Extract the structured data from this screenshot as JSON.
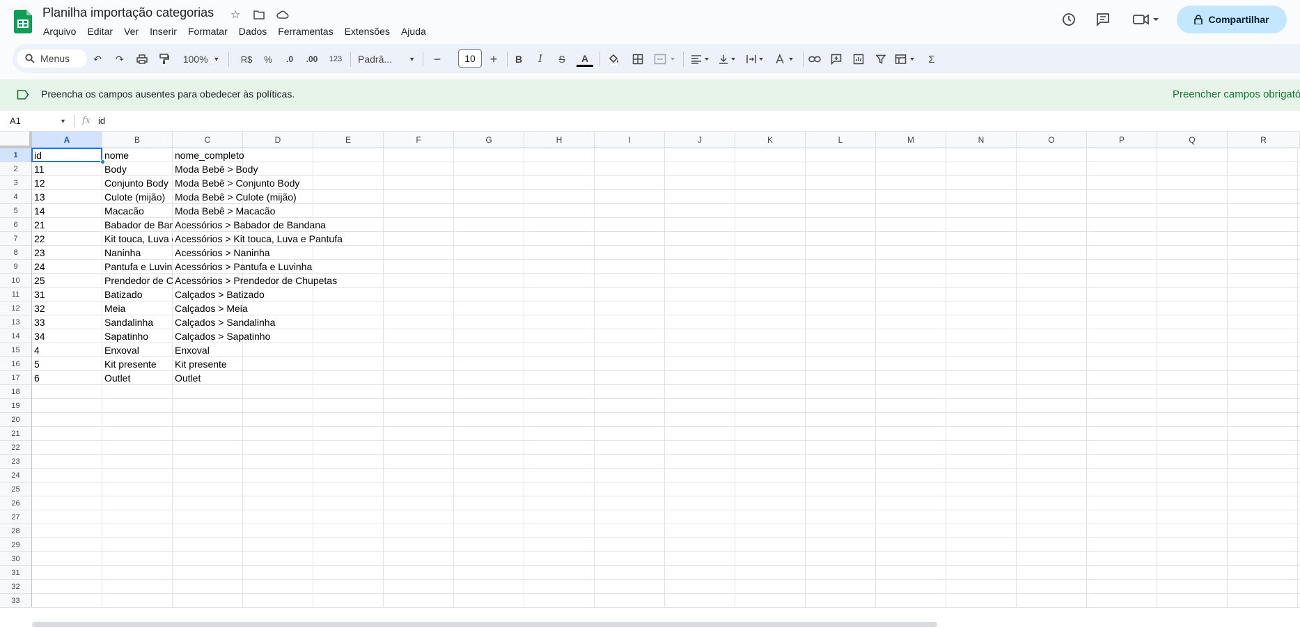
{
  "app": {
    "title": "Planilha importação categorias",
    "menu": [
      "Arquivo",
      "Editar",
      "Ver",
      "Inserir",
      "Formatar",
      "Dados",
      "Ferramentas",
      "Extensões",
      "Ajuda"
    ],
    "share_label": "Compartilhar"
  },
  "toolbar": {
    "search_label": "Menus",
    "zoom": "100%",
    "currency": "R$",
    "percent": "%",
    "dec_less": ".0",
    "dec_more": ".00",
    "number_format": "123",
    "font_name": "Padrã...",
    "font_size": "10",
    "minus": "−",
    "plus": "+",
    "bold": "B",
    "italic": "I",
    "strike": "S",
    "text_color": "A",
    "sum": "Σ"
  },
  "banner": {
    "text": "Preencha os campos ausentes para obedecer às políticas.",
    "action": "Preencher campos obrigatórios"
  },
  "formula_bar": {
    "cell_ref": "A1",
    "fx": "fx",
    "value": "id"
  },
  "sheet": {
    "columns": [
      "A",
      "B",
      "C",
      "D",
      "E",
      "F",
      "G",
      "H",
      "I",
      "J",
      "K",
      "L",
      "M",
      "N",
      "O",
      "P",
      "Q",
      "R"
    ],
    "rows_count": 33,
    "data": [
      [
        "id",
        "nome",
        "nome_completo"
      ],
      [
        "11",
        "Body",
        "Moda Bebê  > Body"
      ],
      [
        "12",
        "Conjunto Body",
        "Moda Bebê  > Conjunto Body"
      ],
      [
        "13",
        "Culote (mijão)",
        "Moda Bebê  > Culote (mijão)"
      ],
      [
        "14",
        "Macacão",
        "Moda Bebê  > Macacão"
      ],
      [
        "21",
        "Babador de Bandana",
        "Acessórios > Babador de Bandana"
      ],
      [
        "22",
        "Kit touca, Luva e Pantufa",
        "Acessórios > Kit touca, Luva e Pantufa"
      ],
      [
        "23",
        "Naninha",
        "Acessórios > Naninha"
      ],
      [
        "24",
        "Pantufa e Luvinha",
        "Acessórios > Pantufa e Luvinha"
      ],
      [
        "25",
        "Prendedor de Chupetas",
        "Acessórios > Prendedor de Chupetas"
      ],
      [
        "31",
        "Batizado",
        "Calçados > Batizado"
      ],
      [
        "32",
        "Meia",
        "Calçados > Meia"
      ],
      [
        "33",
        "Sandalinha",
        "Calçados > Sandalinha"
      ],
      [
        "34",
        "Sapatinho",
        "Calçados > Sapatinho"
      ],
      [
        "4",
        "Enxoval",
        "Enxoval"
      ],
      [
        "5",
        "Kit presente",
        "Kit presente"
      ],
      [
        "6",
        "Outlet",
        "Outlet"
      ]
    ]
  },
  "colors": {
    "accent": "#1a73e8",
    "share_bg": "#c2e7ff",
    "banner_bg": "#e6f4ea",
    "banner_action": "#137333"
  }
}
